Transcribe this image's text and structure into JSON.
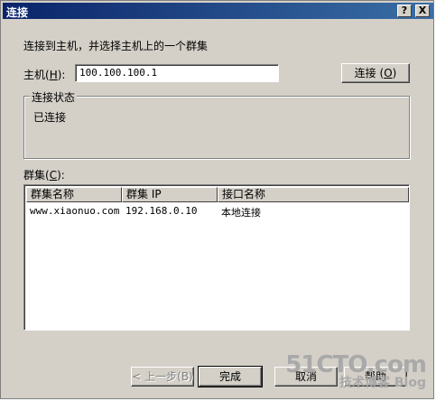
{
  "window": {
    "title": "连接",
    "help_label": "?",
    "close_label": "X"
  },
  "intro": "连接到主机，并选择主机上的一个群集",
  "host": {
    "label": "主机",
    "hotkey": "H",
    "value": "100.100.100.1",
    "connect_label": "连接",
    "connect_hotkey": "O"
  },
  "status_group": {
    "legend": "连接状态",
    "text": "已连接"
  },
  "cluster": {
    "label": "群集",
    "hotkey": "C",
    "columns": [
      "群集名称",
      "群集 IP",
      "接口名称"
    ],
    "rows": [
      {
        "name": "www.xiaonuo.com",
        "ip": "192.168.0.10",
        "iface": "本地连接"
      }
    ]
  },
  "buttons": {
    "back": "< 上一步(B)",
    "finish": "完成",
    "cancel": "取消",
    "help": "帮助"
  },
  "watermark": {
    "site": "51CTO.com",
    "sub": "技术博客",
    "blog": "Blog"
  }
}
